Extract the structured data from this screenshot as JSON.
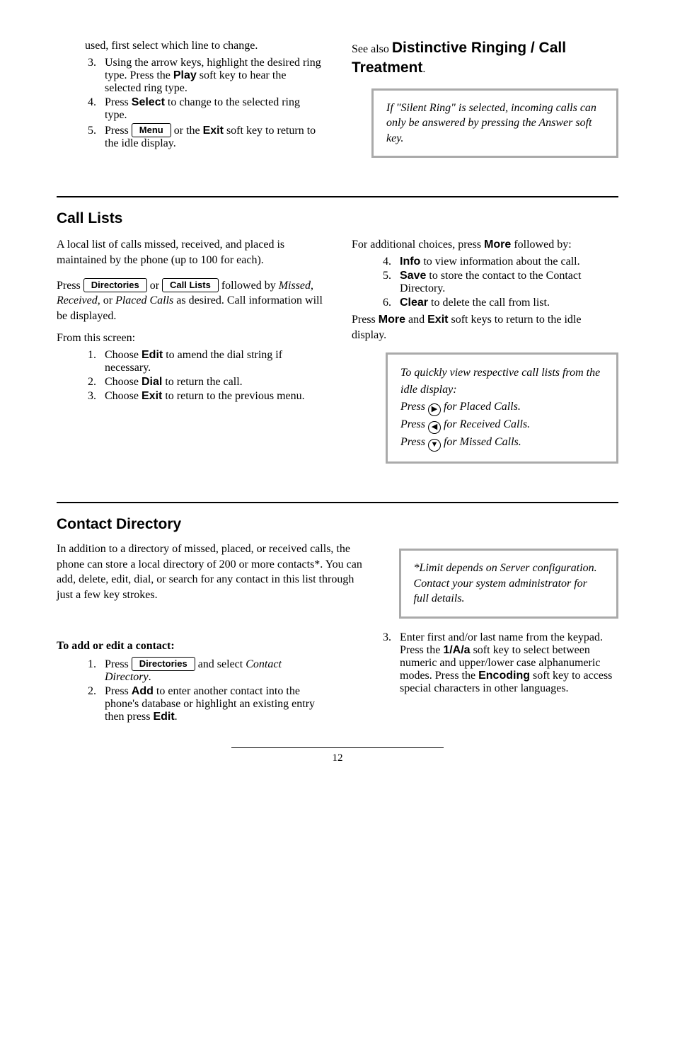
{
  "top": {
    "left": {
      "cont_text": "used, first select which line to change.",
      "li3_a": "Using the arrow keys, highlight the desired ring type.  Press the ",
      "li3_key": "Play",
      "li3_b": " soft key to hear the selected ring type.",
      "li4_a": "Press ",
      "li4_key": "Select",
      "li4_b": " to change to the selected ring type.",
      "li5_a": "Press ",
      "li5_btn": "Menu",
      "li5_b": " or the ",
      "li5_key": "Exit",
      "li5_c": " soft key to return to the idle display."
    },
    "right": {
      "see_a": "See also ",
      "see_b": "Distinctive Ringing / Call Treatment",
      "see_c": ".",
      "callout": "If \"Silent Ring\" is selected, incoming calls can only be answered by pressing the Answer soft key."
    }
  },
  "calllists": {
    "heading": "Call Lists",
    "left": {
      "intro": "A local list of calls missed, received, and placed is maintained by the phone (up to 100 for each).",
      "p2_a": "Press ",
      "p2_btn1": "Directories",
      "p2_b": " or ",
      "p2_btn2": "Call Lists",
      "p2_c": " followed by ",
      "p2_d": "Missed",
      "p2_e": ", ",
      "p2_f": "Received",
      "p2_g": ", or ",
      "p2_h": "Placed Calls",
      "p2_i": " as desired.  Call information will be displayed.",
      "from": "From this screen:",
      "li1_a": "Choose ",
      "li1_key": "Edit",
      "li1_b": " to amend the dial string if necessary.",
      "li2_a": "Choose ",
      "li2_key": "Dial",
      "li2_b": " to return the call.",
      "li3_a": "Choose ",
      "li3_key": "Exit",
      "li3_b": " to return to the previous menu."
    },
    "right": {
      "p1_a": "For additional choices, press ",
      "p1_key": "More",
      "p1_b": " followed by:",
      "li4_key": "Info",
      "li4_b": " to view information about the call.",
      "li5_key": "Save",
      "li5_b": " to store the contact to the Contact Directory.",
      "li6_key": "Clear",
      "li6_b": " to delete the call from list.",
      "p2_a": "Press ",
      "p2_key1": "More",
      "p2_b": " and ",
      "p2_key2": "Exit",
      "p2_c": " soft keys to return to the idle display.",
      "callout_l1": "To quickly view respective call lists from the idle display:",
      "callout_l2a": "Press ",
      "callout_l2b": " for Placed Calls.",
      "callout_l3a": "Press ",
      "callout_l3b": " for Received Calls.",
      "callout_l4a": "Press ",
      "callout_l4b": " for Missed Calls."
    }
  },
  "contact": {
    "heading": "Contact Directory",
    "intro": "In addition to a directory of missed, placed, or received calls, the phone can store a local directory of 200 or more contacts*.  You can add, delete, edit, dial,  or search for any contact in this list through just a few key strokes.",
    "callout": "*Limit depends on Server configuration.  Contact your system administrator for full details.",
    "subhead": "To add or edit a contact:",
    "left": {
      "li1_a": "Press ",
      "li1_btn": "Directories",
      "li1_b": " and select ",
      "li1_c": "Contact Directory",
      "li1_d": ".",
      "li2_a": "Press ",
      "li2_key": "Add",
      "li2_b": " to enter another contact into the phone's database or highlight an existing entry then press ",
      "li2_key2": "Edit",
      "li2_c": "."
    },
    "right": {
      "li3_a": "Enter first and/or last name from the keypad.  Press the ",
      "li3_key1": "1/A/a",
      "li3_b": " soft key to select between numeric and upper/lower case alphanumeric modes. Press the ",
      "li3_key2": "Encoding",
      "li3_c": " soft key to access special characters in other languages."
    }
  },
  "page_number": "12"
}
